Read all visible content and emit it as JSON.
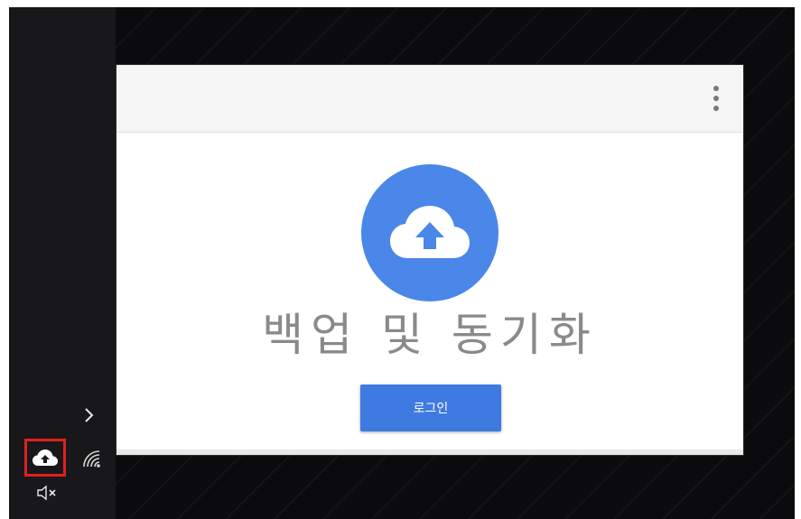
{
  "app": {
    "title": "백업 및 동기화",
    "login_label": "로그인"
  },
  "taskbar": {
    "chevron": "›",
    "volume_icon": "🔇",
    "icons": [
      "chevron-right-icon",
      "backup-cloud-icon",
      "network-icon",
      "volume-muted-icon"
    ]
  },
  "colors": {
    "accent_blue": "#4a87e8",
    "button_blue": "#3f7ae0",
    "highlight_red": "#e02020",
    "background_dark": "#0b0b0d"
  }
}
